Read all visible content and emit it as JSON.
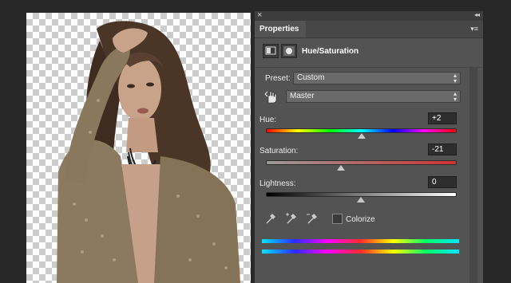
{
  "panel": {
    "title": "Properties",
    "adjustment_title": "Hue/Saturation",
    "preset_label": "Preset:",
    "preset_value": "Custom",
    "channel_value": "Master",
    "hue_label": "Hue:",
    "hue_value": "+2",
    "saturation_label": "Saturation:",
    "saturation_value": "-21",
    "lightness_label": "Lightness:",
    "lightness_value": "0",
    "colorize_label": "Colorize",
    "colorize_checked": false
  },
  "icons": {
    "close": "close-icon",
    "collapse": "double-chevron-icon",
    "panel_menu": "panel-menu-icon",
    "adjustment_layer": "adjustment-layer-icon",
    "layer_mask": "layer-mask-icon",
    "targeted_adjust": "hand-adjust-icon",
    "eyedropper": "eyedropper-icon",
    "eyedropper_add": "eyedropper-plus-icon",
    "eyedropper_subtract": "eyedropper-minus-icon"
  },
  "slider_levels": {
    "hue": 2,
    "saturation": -21,
    "lightness": 0
  }
}
